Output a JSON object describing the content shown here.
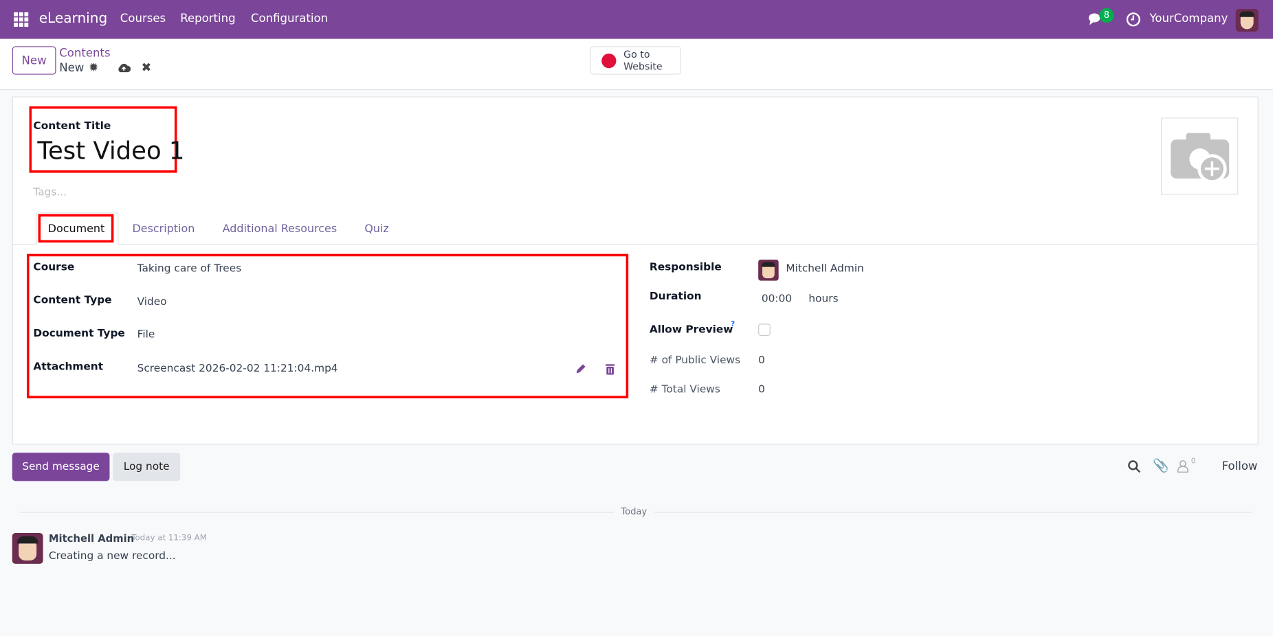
{
  "navbar": {
    "app_name": "eLearning",
    "menu": [
      "Courses",
      "Reporting",
      "Configuration"
    ],
    "messages_badge": "8",
    "company": "YourCompany",
    "color": "#7b4699"
  },
  "control_panel": {
    "new_label": "New",
    "breadcrumb_parent": "Contents",
    "breadcrumb_current": "New",
    "go_to_website": [
      "Go to",
      "Website"
    ]
  },
  "form": {
    "title_label": "Content Title",
    "title_value": "Test Video 1",
    "tags_placeholder": "Tags...",
    "tabs": [
      "Document",
      "Description",
      "Additional Resources",
      "Quiz"
    ],
    "active_tab": "Document",
    "left_fields": [
      {
        "label": "Course",
        "value": "Taking care of Trees"
      },
      {
        "label": "Content Type",
        "value": "Video"
      },
      {
        "label": "Document Type",
        "value": "File"
      },
      {
        "label": "Attachment",
        "value": "Screencast 2026-02-02 11:21:04.mp4"
      }
    ],
    "right_fields": {
      "responsible_label": "Responsible",
      "responsible_value": "Mitchell Admin",
      "duration_label": "Duration",
      "duration_value": "00:00",
      "duration_unit": "hours",
      "allow_preview_label": "Allow Preview",
      "allow_preview_help": "?",
      "allow_preview_checked": false,
      "public_views_label": "# of Public Views",
      "public_views_value": "0",
      "total_views_label": "# Total Views",
      "total_views_value": "0"
    }
  },
  "chatter": {
    "send_message": "Send message",
    "log_note": "Log note",
    "followers_count": "0",
    "follow": "Follow",
    "date_separator": "Today",
    "messages": [
      {
        "author": "Mitchell Admin",
        "time": "Today at 11:39 AM",
        "body": "Creating a new record..."
      }
    ]
  }
}
